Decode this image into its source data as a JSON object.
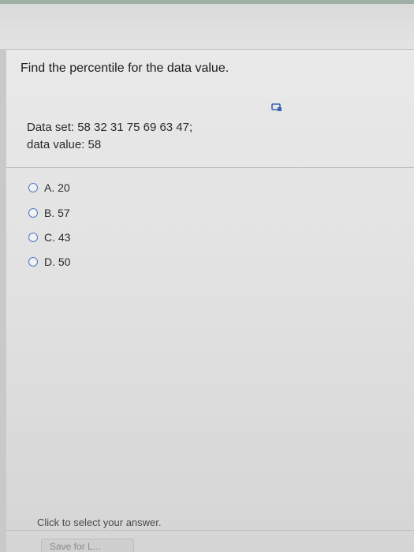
{
  "question": {
    "title": "Find the percentile for the data value.",
    "data_set": "Data set: 58  32  31  75  69  63  47;",
    "data_value": "data value: 58",
    "help_icon": "clipboard-icon"
  },
  "options": [
    {
      "text": "A.  20"
    },
    {
      "text": "B.  57"
    },
    {
      "text": "C.  43"
    },
    {
      "text": "D.  50"
    }
  ],
  "footer": {
    "hint": "Click to select your answer.",
    "save_label": "Save for L..."
  },
  "colors": {
    "radio_border": "#4b78c4",
    "panel_bg": "#e6e6e6"
  }
}
